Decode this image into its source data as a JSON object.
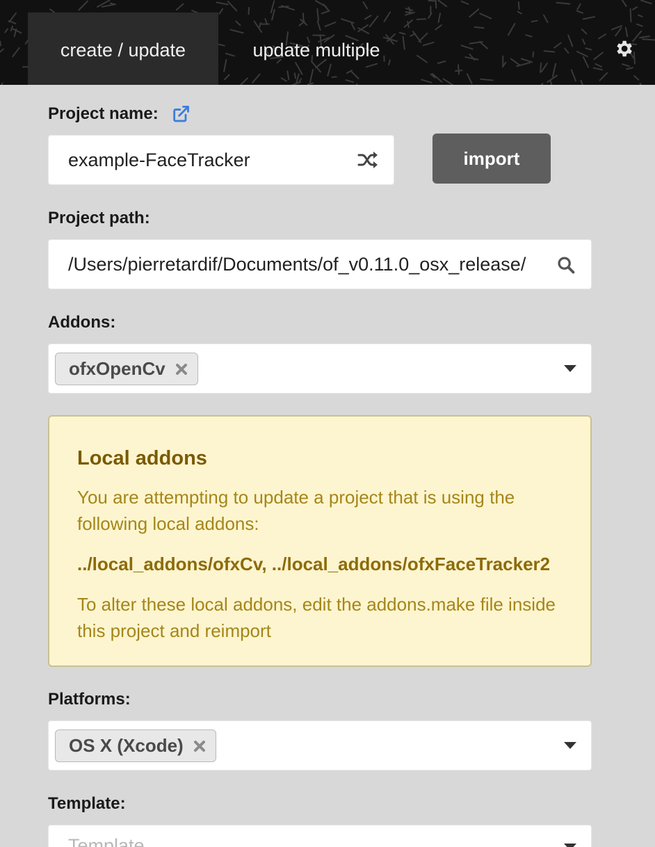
{
  "tabs": [
    {
      "label": "create / update",
      "active": true
    },
    {
      "label": "update multiple",
      "active": false
    }
  ],
  "project_name": {
    "label": "Project name:",
    "value": "example-FaceTracker"
  },
  "import_button": "import",
  "project_path": {
    "label": "Project path:",
    "value": "/Users/pierretardif/Documents/of_v0.11.0_osx_release/"
  },
  "addons": {
    "label": "Addons:",
    "selected": [
      "ofxOpenCv"
    ]
  },
  "local_addons_warning": {
    "title": "Local addons",
    "message": "You are attempting to update a project that is using the following local addons:",
    "paths": "../local_addons/ofxCv, ../local_addons/ofxFaceTracker2",
    "instructions": "To alter these local addons, edit the addons.make file inside this project and reimport"
  },
  "platforms": {
    "label": "Platforms:",
    "selected": [
      "OS X (Xcode)"
    ]
  },
  "template": {
    "label": "Template:",
    "placeholder": "Template"
  },
  "colors": {
    "topbar": "#111111",
    "active_tab": "#2b2b2b",
    "background": "#d8d8d8",
    "import_button": "#5e5e5e",
    "warning_bg": "#fdf5cf",
    "warning_text": "#a5861a",
    "link_icon": "#3b7ddd"
  },
  "icons": [
    "gear-icon",
    "external-link-icon",
    "shuffle-icon",
    "search-icon",
    "remove-icon",
    "dropdown-caret-icon"
  ]
}
